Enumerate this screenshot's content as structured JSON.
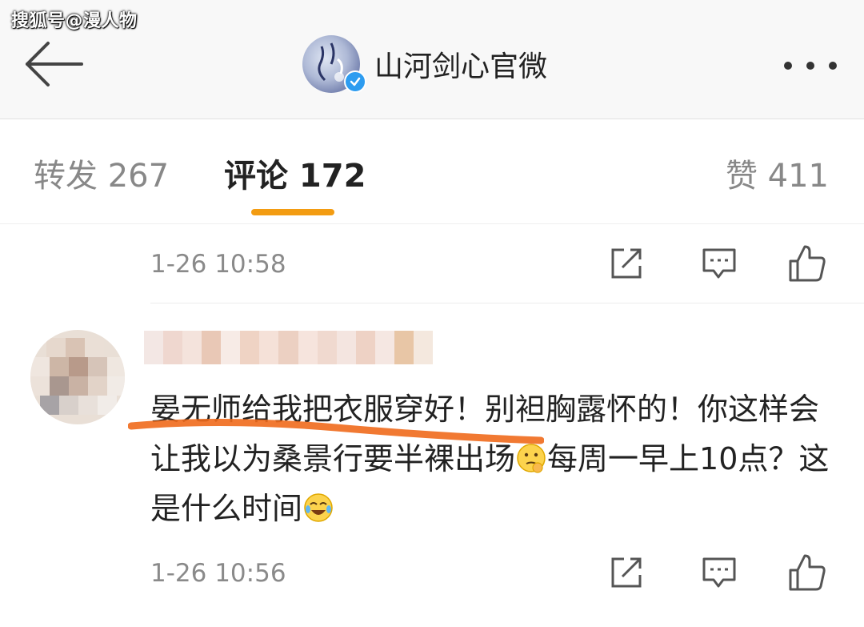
{
  "watermark": "搜狐号@漫人物",
  "header": {
    "account_name": "山河剑心官微",
    "verified": true,
    "back_icon": "arrow-left-icon",
    "more_icon": "more-dots-icon"
  },
  "tabs": [
    {
      "label": "转发 267",
      "active": false
    },
    {
      "label": "评论 172",
      "active": true
    },
    {
      "label": "赞 411",
      "active": false
    }
  ],
  "colors": {
    "accent": "#f39c12",
    "verified": "#2d9cf0",
    "meta_text": "#8a8a8a",
    "header_bg": "#f8f8f8"
  },
  "post_meta": {
    "time": "1-26 10:58"
  },
  "comment": {
    "author_name": "",
    "text_part1": "晏无师给我把衣服穿好！别袒胸露怀的！你这样会让我以为桑景行要半裸出场",
    "text_part2": "每周一早上10点？这是什么时间",
    "emoji_1": "thinking-face-icon",
    "emoji_2": "laughing-crying-icon",
    "time": "1-26 10:56"
  },
  "actions": {
    "share_icon": "share-icon",
    "reply_icon": "comment-icon",
    "like_icon": "thumbs-up-icon"
  }
}
